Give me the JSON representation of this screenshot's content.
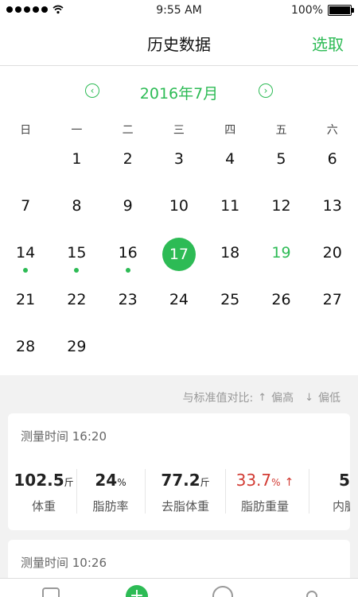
{
  "status_bar": {
    "time": "9:55 AM",
    "battery": "100%"
  },
  "nav": {
    "title": "历史数据",
    "action": "选取"
  },
  "calendar": {
    "month_label": "2016年7月",
    "weekdays": [
      "日",
      "一",
      "二",
      "三",
      "四",
      "五",
      "六"
    ],
    "weeks": [
      [
        null,
        "1",
        "2",
        "3",
        "4",
        "5",
        "6"
      ],
      [
        "7",
        "8",
        "9",
        "10",
        "11",
        "12",
        "13"
      ],
      [
        "14",
        "15",
        "16",
        "17",
        "18",
        "19",
        "20"
      ],
      [
        "21",
        "22",
        "23",
        "24",
        "25",
        "26",
        "27"
      ],
      [
        "28",
        "29",
        null,
        null,
        null,
        null,
        null
      ]
    ],
    "selected_day": "17",
    "green_days": [
      "19"
    ],
    "dotted_days": [
      "14",
      "15",
      "16"
    ]
  },
  "legend": {
    "label": "与标准值对比:",
    "high": "偏高",
    "low": "偏低"
  },
  "records": [
    {
      "time": "测量时间 16:20",
      "metrics": [
        {
          "value": "102.5",
          "unit": "斤",
          "name": "体重"
        },
        {
          "value": "24",
          "unit": "%",
          "name": "脂肪率"
        },
        {
          "value": "77.2",
          "unit": "斤",
          "name": "去脂体重"
        },
        {
          "value": "33.7",
          "unit": "%",
          "name": "脂肪重量",
          "status": "high"
        },
        {
          "value": "5",
          "unit": "",
          "name": "内脏"
        }
      ]
    },
    {
      "time": "测量时间 10:26"
    }
  ],
  "colors": {
    "accent": "#2dbb55",
    "high": "#d23b33"
  },
  "tabs": [
    {
      "icon": "shield-icon"
    },
    {
      "icon": "plus-icon"
    },
    {
      "icon": "compass-icon"
    },
    {
      "icon": "person-icon"
    }
  ]
}
